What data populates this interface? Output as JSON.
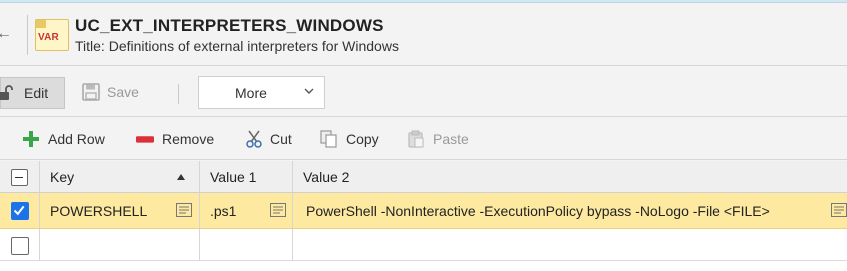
{
  "header": {
    "back_icon": "arrow-left-icon",
    "object_icon_label": "VAR",
    "object_name": "UC_EXT_INTERPRETERS_WINDOWS",
    "object_title": "Title: Definitions of external interpreters for Windows"
  },
  "toolbar": {
    "edit_label": "Edit",
    "save_label": "Save",
    "more_label": "More"
  },
  "row_toolbar": {
    "add_row_label": "Add Row",
    "remove_label": "Remove",
    "cut_label": "Cut",
    "copy_label": "Copy",
    "paste_label": "Paste"
  },
  "table": {
    "columns": [
      "Key",
      "Value 1",
      "Value 2"
    ],
    "sort_column": "Key",
    "sort_direction": "ascending",
    "rows": [
      {
        "selected": true,
        "key": "POWERSHELL",
        "value1": ".ps1",
        "value2": "PowerShell -NonInteractive -ExecutionPolicy bypass -NoLogo -File <FILE>"
      },
      {
        "selected": false,
        "key": "",
        "value1": "",
        "value2": ""
      }
    ]
  },
  "colors": {
    "selected_row": "#fde9a0",
    "checkbox_checked": "#1a73e8",
    "remove_icon": "#d9303a",
    "add_icon": "#3aa64a"
  }
}
